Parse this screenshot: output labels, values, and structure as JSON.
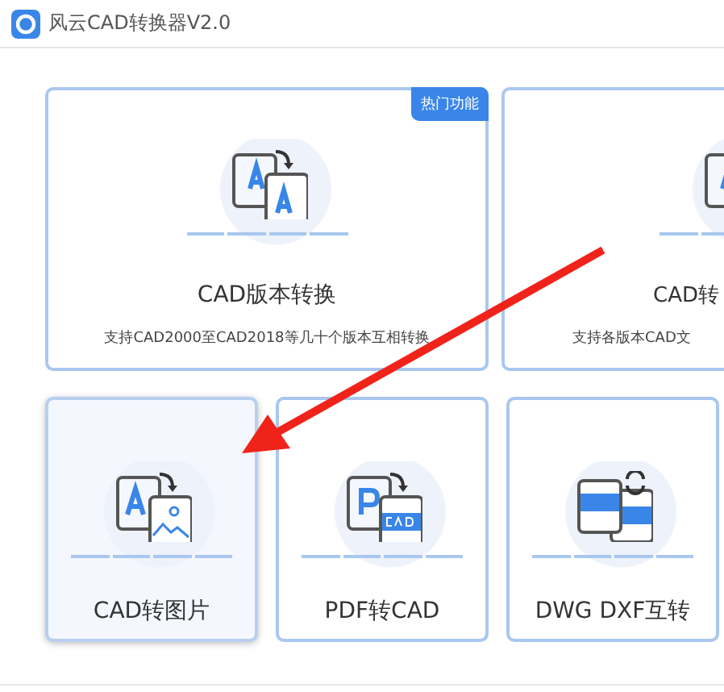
{
  "window": {
    "title": "风云CAD转换器V2.0"
  },
  "feature_cards": [
    {
      "kind": "full",
      "title": "CAD版本转换",
      "description": "支持CAD2000至CAD2018等几十个版本互相转换",
      "badge": "热门功能",
      "selected": false
    },
    {
      "kind": "partial",
      "title": "CAD转",
      "description": "支持各版本CAD文",
      "selected": false
    }
  ],
  "tool_cards": [
    {
      "kind": "image",
      "title": "CAD转图片",
      "selected": true
    },
    {
      "kind": "pdf",
      "title": "PDF转CAD",
      "selected": false
    },
    {
      "kind": "dwg",
      "title": "DWG DXF互转",
      "selected": false
    }
  ]
}
